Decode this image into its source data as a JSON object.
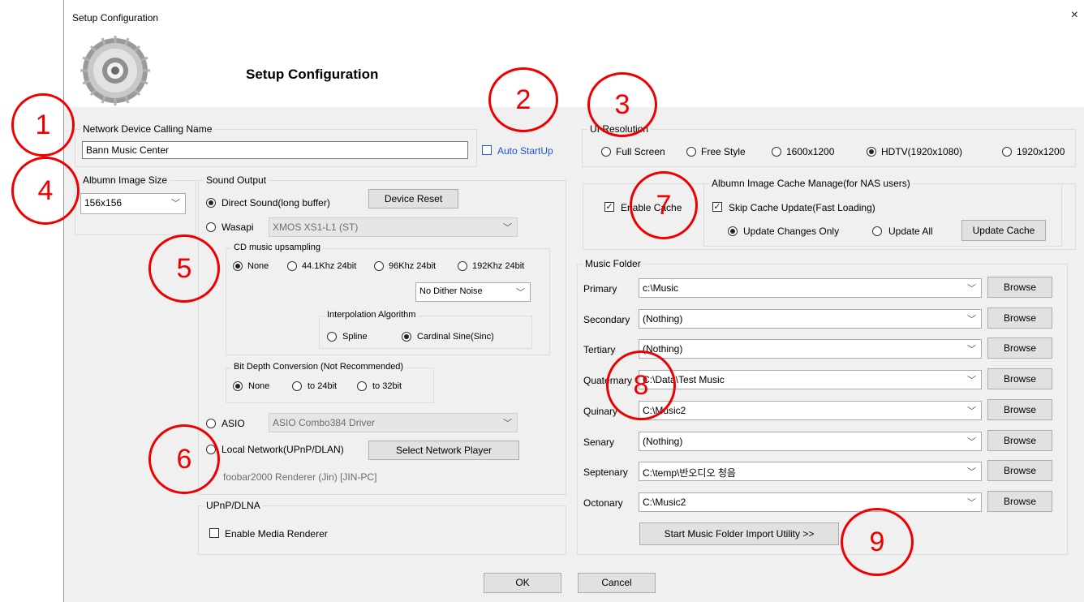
{
  "window": {
    "title": "Setup Configuration",
    "close": "×"
  },
  "header": {
    "title": "Setup Configuration"
  },
  "network": {
    "label": "Network Device Calling Name",
    "value": "Bann Music Center",
    "auto_startup": "Auto StartUp"
  },
  "ui_resolution": {
    "label": "UI Resolution",
    "options": [
      "Full Screen",
      "Free Style",
      "1600x1200",
      "HDTV(1920x1080)",
      "1920x1200"
    ],
    "selected": "HDTV(1920x1080)"
  },
  "album_image_size": {
    "label": "Albumn Image Size",
    "value": "156x156"
  },
  "sound_output": {
    "label": "Sound Output",
    "direct_sound": "Direct Sound(long buffer)",
    "device_reset": "Device Reset",
    "wasapi": "Wasapi",
    "wasapi_device": "XMOS XS1-L1 (ST)",
    "cd_upsampling": {
      "label": "CD music upsampling",
      "options": [
        "None",
        "44.1Khz 24bit",
        "96Khz 24bit",
        "192Khz 24bit"
      ],
      "dither": "No Dither Noise"
    },
    "interpolation": {
      "label": "Interpolation Algorithm",
      "options": [
        "Spline",
        "Cardinal Sine(Sinc)"
      ]
    },
    "bit_depth": {
      "label": "Bit Depth Conversion (Not Recommended)",
      "options": [
        "None",
        "to 24bit",
        "to 32bit"
      ]
    },
    "asio": "ASIO",
    "asio_device": "ASIO Combo384 Driver",
    "local_network": "Local Network(UPnP/DLAN)",
    "select_player": "Select Network Player",
    "renderer": "foobar2000 Renderer (Jin) [JIN-PC]"
  },
  "upnp": {
    "label": "UPnP/DLNA",
    "enable_renderer": "Enable Media Renderer"
  },
  "cache": {
    "enable": "Enable Cache",
    "group_label": "Albumn Image Cache Manage(for NAS users)",
    "skip": "Skip Cache Update(Fast Loading)",
    "update_changes": "Update Changes Only",
    "update_all": "Update All",
    "update_button": "Update Cache"
  },
  "music_folder": {
    "label": "Music Folder",
    "browse": "Browse",
    "rows": [
      {
        "name": "Primary",
        "value": "c:\\Music"
      },
      {
        "name": "Secondary",
        "value": "(Nothing)"
      },
      {
        "name": "Tertiary",
        "value": "(Nothing)"
      },
      {
        "name": "Quaternary",
        "value": "C:\\Data\\Test Music"
      },
      {
        "name": "Quinary",
        "value": "C:\\Music2"
      },
      {
        "name": "Senary",
        "value": "(Nothing)"
      },
      {
        "name": "Septenary",
        "value": "C:\\temp\\반오디오 청음"
      },
      {
        "name": "Octonary",
        "value": "C:\\Music2"
      }
    ],
    "import_utility": "Start Music Folder Import Utility >>"
  },
  "footer": {
    "ok": "OK",
    "cancel": "Cancel"
  },
  "callouts": [
    "1",
    "2",
    "3",
    "4",
    "5",
    "6",
    "7",
    "8",
    "9"
  ],
  "colors": {
    "callout": "#ee0000",
    "link": "#1a56d6",
    "dialog_bg": "#f0f0f0"
  }
}
